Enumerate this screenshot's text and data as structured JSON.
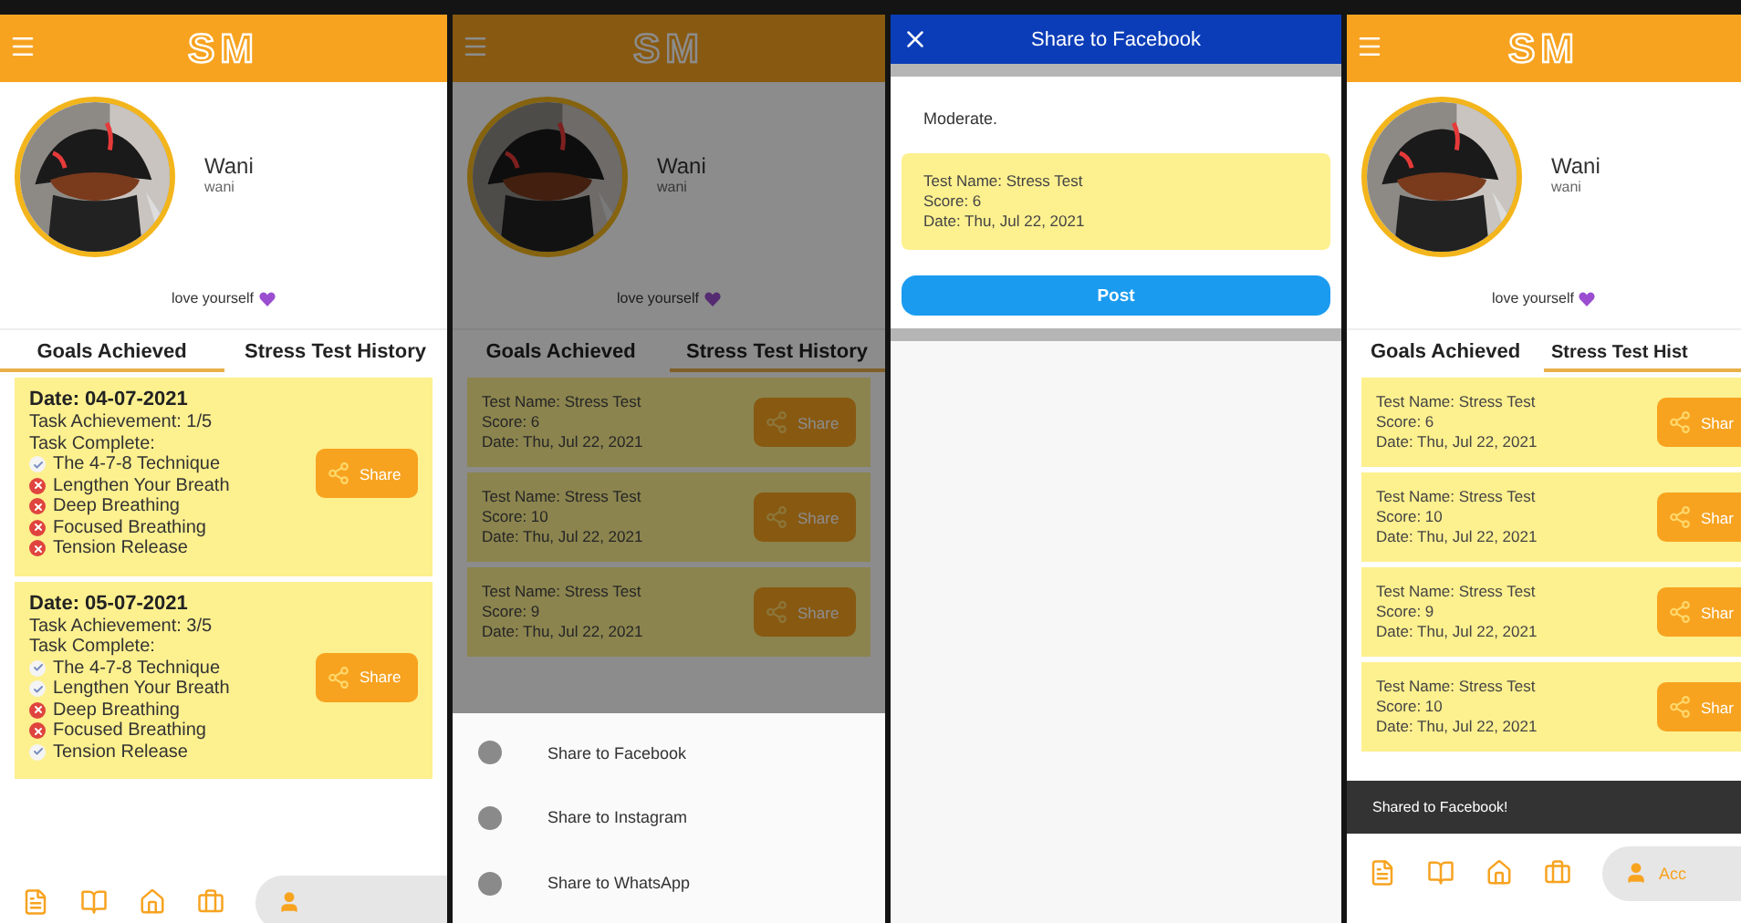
{
  "screens": [
    {
      "kind": "goals",
      "app_bar": {
        "title": "SM"
      },
      "profile": {
        "name": "Wani",
        "username": "wani",
        "bio": "love yourself"
      },
      "tabs": [
        {
          "label": "Goals Achieved",
          "selected": true
        },
        {
          "label": "Stress Test History",
          "selected": false
        }
      ],
      "goals": [
        {
          "date": "Date: 04-07-2021",
          "achievement": "Task Achievement: 1/5",
          "heading": "Task Complete:",
          "share": "Share",
          "tasks": [
            {
              "name": "The 4-7-8 Technique",
              "done": true
            },
            {
              "name": "Lengthen Your Breath",
              "done": false
            },
            {
              "name": "Deep Breathing",
              "done": false
            },
            {
              "name": "Focused Breathing",
              "done": false
            },
            {
              "name": "Tension Release",
              "done": false
            }
          ]
        },
        {
          "date": "Date: 05-07-2021",
          "achievement": "Task Achievement: 3/5",
          "heading": "Task Complete:",
          "share": "Share",
          "tasks": [
            {
              "name": "The 4-7-8 Technique",
              "done": true
            },
            {
              "name": "Lengthen Your Breath",
              "done": true
            },
            {
              "name": "Deep Breathing",
              "done": false
            },
            {
              "name": "Focused Breathing",
              "done": false
            },
            {
              "name": "Tension Release",
              "done": true
            }
          ]
        }
      ],
      "nav": [
        {
          "selected": false
        },
        {
          "selected": false
        },
        {
          "selected": false
        },
        {
          "selected": false
        },
        {
          "selected": true
        }
      ]
    },
    {
      "kind": "history",
      "dimmed": true,
      "app_bar": {
        "title": "SM"
      },
      "profile": {
        "name": "Wani",
        "username": "wani",
        "bio": "love yourself"
      },
      "tabs": [
        {
          "label": "Goals Achieved",
          "selected": false
        },
        {
          "label": "Stress Test History",
          "selected": true
        }
      ],
      "tests": [
        {
          "name": "Test Name:  Stress Test",
          "score": "Score: 6",
          "date": "Date: Thu, Jul 22, 2021",
          "share": "Share"
        },
        {
          "name": "Test Name:  Stress Test",
          "score": "Score: 10",
          "date": "Date: Thu, Jul 22, 2021",
          "share": "Share"
        },
        {
          "name": "Test Name:  Stress Test",
          "score": "Score: 9",
          "date": "Date: Thu, Jul 22, 2021",
          "share": "Share"
        }
      ],
      "sheet": [
        {
          "label": "Share to Facebook"
        },
        {
          "label": "Share to Instagram"
        },
        {
          "label": "Share to WhatsApp"
        }
      ]
    },
    {
      "kind": "dialog",
      "title": "Share to Facebook",
      "message": "Moderate.",
      "test": {
        "name": "Test Name:  Stress Test",
        "score": "Score: 6",
        "date": "Date: Thu, Jul 22, 2021"
      },
      "button": "Post"
    },
    {
      "kind": "history",
      "cropped": true,
      "app_bar": {
        "title": "SM"
      },
      "profile": {
        "name": "Wani",
        "username": "wani",
        "bio": "love yourself"
      },
      "tabs": [
        {
          "label": "Goals Achieved",
          "selected": false
        },
        {
          "label": "Stress Test Hist",
          "selected": true
        }
      ],
      "tests": [
        {
          "name": "Test Name:  Stress Test",
          "score": "Score: 6",
          "date": "Date: Thu, Jul 22, 2021",
          "share": "Shar"
        },
        {
          "name": "Test Name:  Stress Test",
          "score": "Score: 10",
          "date": "Date: Thu, Jul 22, 2021",
          "share": "Shar"
        },
        {
          "name": "Test Name:  Stress Test",
          "score": "Score: 9",
          "date": "Date: Thu, Jul 22, 2021",
          "share": "Shar"
        },
        {
          "name": "Test Name:  Stress Test",
          "score": "Score: 10",
          "date": "Date: Thu, Jul 22, 2021",
          "share": "Shar"
        }
      ],
      "snackbar": "Shared to Facebook!",
      "nav": [
        {
          "selected": false
        },
        {
          "selected": false
        },
        {
          "selected": false
        },
        {
          "selected": false
        },
        {
          "selected": true,
          "label": "Acc"
        }
      ]
    }
  ]
}
